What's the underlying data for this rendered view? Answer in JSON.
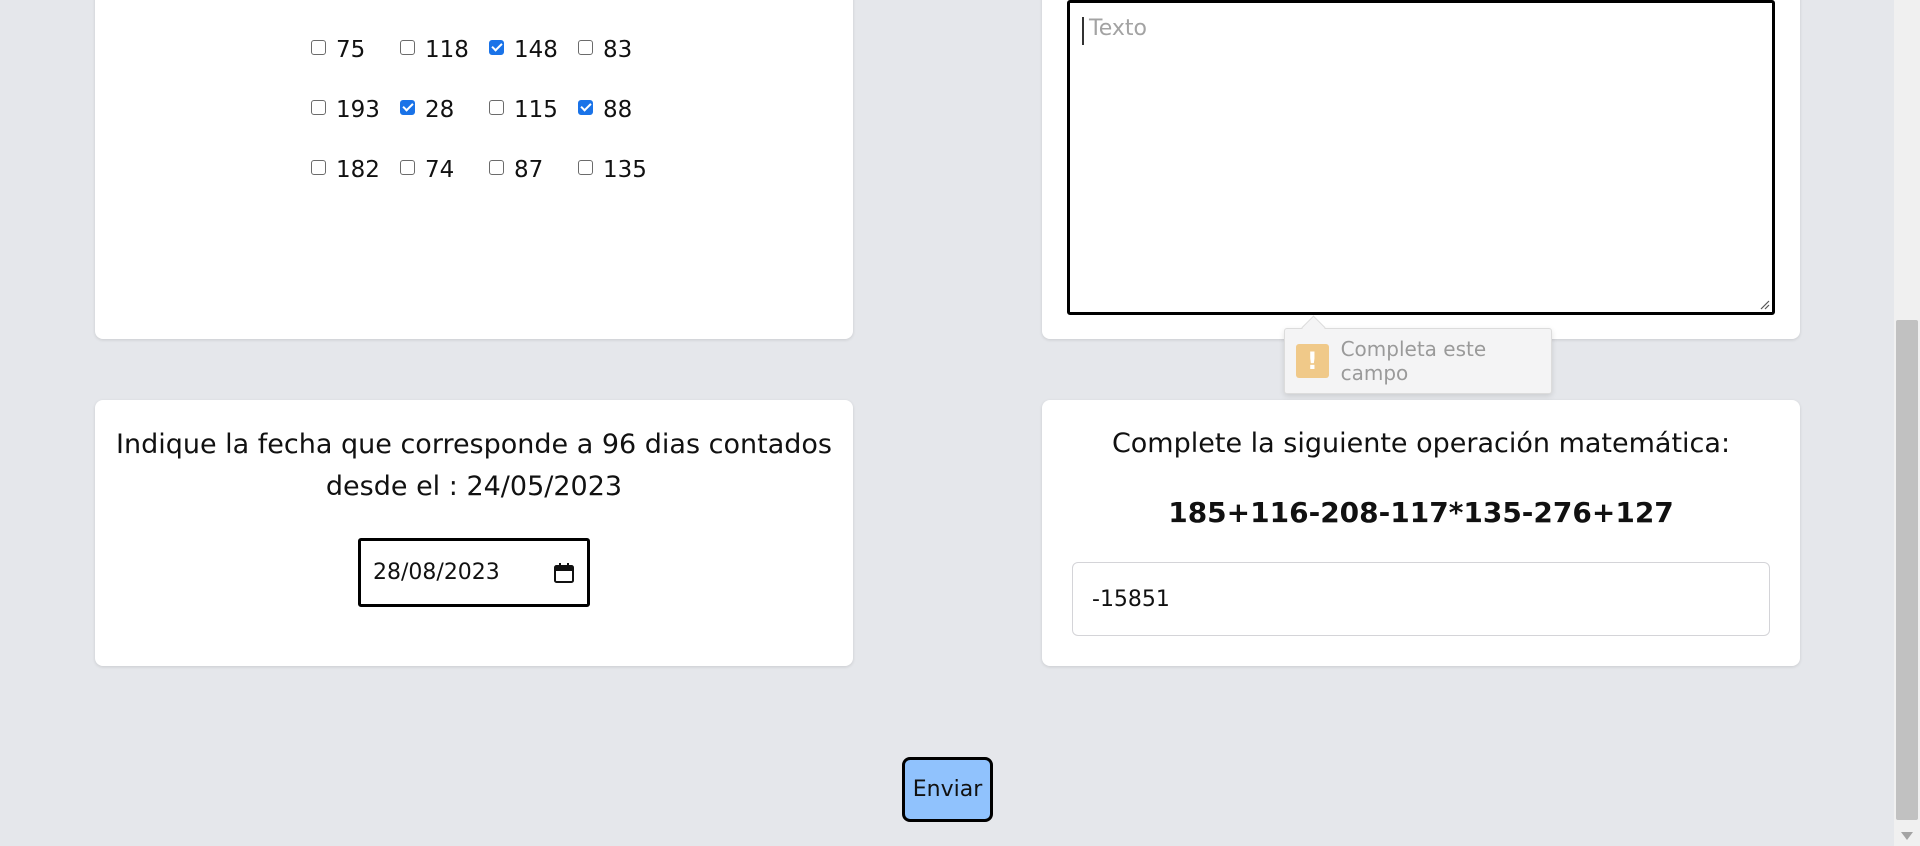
{
  "checkbox_question": {
    "rows": [
      [
        {
          "label": "75",
          "checked": false
        },
        {
          "label": "118",
          "checked": false
        },
        {
          "label": "148",
          "checked": true
        },
        {
          "label": "83",
          "checked": false
        }
      ],
      [
        {
          "label": "193",
          "checked": false
        },
        {
          "label": "28",
          "checked": true
        },
        {
          "label": "115",
          "checked": false
        },
        {
          "label": "88",
          "checked": true
        }
      ],
      [
        {
          "label": "182",
          "checked": false
        },
        {
          "label": "74",
          "checked": false
        },
        {
          "label": "87",
          "checked": false
        },
        {
          "label": "135",
          "checked": false
        }
      ]
    ]
  },
  "text_question": {
    "placeholder": "Texto",
    "value": ""
  },
  "validation_tooltip": {
    "icon": "warning-icon",
    "message": "Completa este campo"
  },
  "date_question": {
    "text_line1": "Indique la fecha que corresponde a 96 dias contados",
    "text_line2": "desde el : 24/05/2023",
    "value": "28/08/2023",
    "icon": "calendar-icon"
  },
  "math_question": {
    "title": "Complete la siguiente operación matemática:",
    "expression": "185+116-208-117*135-276+127",
    "answer": "-15851"
  },
  "submit": {
    "label": "Enviar",
    "color": "#90c2fd"
  },
  "colors": {
    "background": "#e5e7eb",
    "checkbox_checked": "#1a73e8",
    "warning": "#f0c989"
  }
}
